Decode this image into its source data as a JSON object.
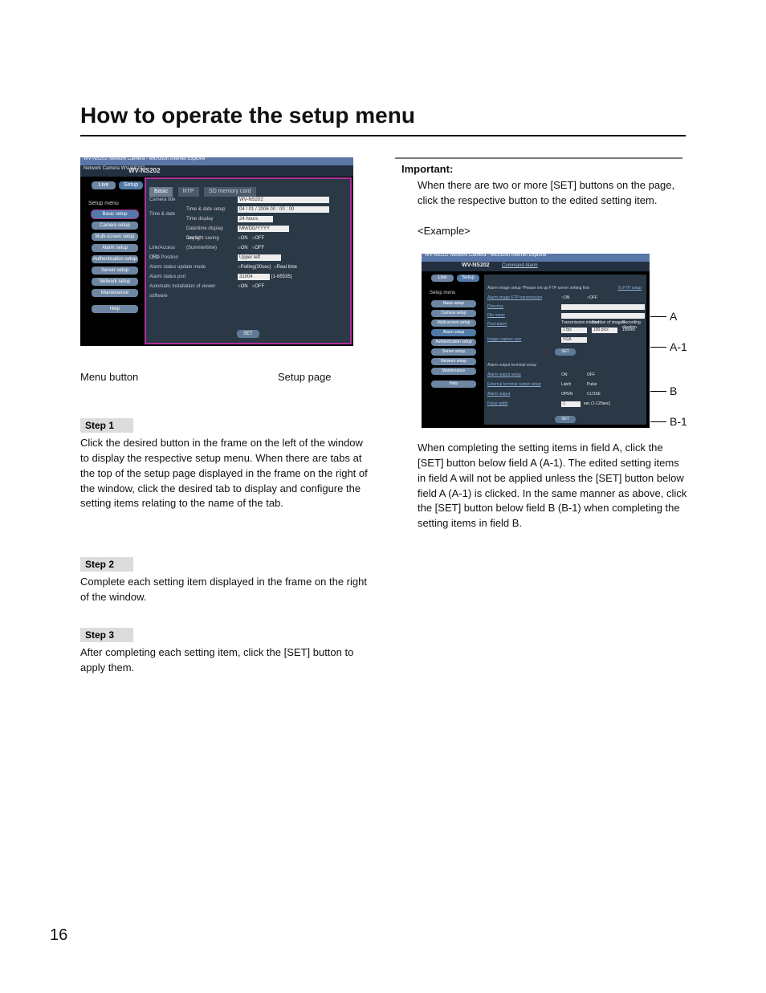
{
  "title": "How to operate the setup menu",
  "pageNumber": "16",
  "leftColumn": {
    "shot1": {
      "windowTitle": "WV-NS202 Network Camera - Microsoft Internet Explorer",
      "cameraLabel": "Network Camera\nWV-NS202",
      "cameraTag": "WV-NS202",
      "topBtnLive": "Live",
      "topBtnSetup": "Setup",
      "menuTitle": "Setup menu",
      "menuItems": [
        "Basic setup",
        "Camera setup",
        "Multi-screen setup",
        "Alarm setup",
        "Authentication setup",
        "Server setup",
        "Network setup",
        "Maintenance",
        "Help"
      ],
      "tabs": [
        "Basic",
        "NTP",
        "SD memory card"
      ],
      "rows": {
        "camTitleLabel": "Camera title",
        "camTitleValue": "WV-NS202",
        "timeSection": "Time & date",
        "tds": "Time & date setup",
        "tds_value": "04 / 01 / 2006   00 : 00 : 00",
        "td_disp": "Time display",
        "td_disp_value": "24 hours",
        "dtf": "Date/time display format",
        "dtf_value": "MM/DD/YYYY",
        "dls": "Daylight saving (Summertime)",
        "dls_on": "ON",
        "dls_off": "OFF",
        "led": "Link/Access LED",
        "led_on": "ON",
        "led_off": "OFF",
        "osd": "OSD Position",
        "osd_value": "Upper left",
        "asum": "Alarm status update mode",
        "asum_a": "Polling(30sec)",
        "asum_b": "Real time",
        "asp": "Alarm status port",
        "asp_val": "31004",
        "asp_hint": "(1-65535)",
        "auto": "Automatic installation of viewer software",
        "auto_on": "ON",
        "auto_off": "OFF",
        "setBtn": "SET"
      },
      "label_menu": "Menu button",
      "label_page": "Setup page"
    },
    "step1": {
      "title": "Step 1",
      "body": "Click the desired button in the frame on the left of the window to display the respective setup menu.\nWhen there are tabs at the top of the setup page displayed in the frame on the right of the window, click the desired tab to display and configure the setting items relating to the name of the tab."
    },
    "step2": {
      "title": "Step 2",
      "body": "Complete each setting item displayed in the frame on the right of the window."
    },
    "step3": {
      "title": "Step 3",
      "body": "After completing each setting item, click the [SET] button to apply them."
    }
  },
  "rightColumn": {
    "important": "Important:",
    "importantBody": "When there are two or more [SET] buttons on the page, click the respective button to the edited setting item.",
    "exampleLabel": "<Example>",
    "shot2": {
      "windowTitle": "WV-NS202 Network Camera - Microsoft Internet Explorer",
      "cameraTag": "WV-NS202",
      "cameraAlarm": "Command Alarm",
      "topBtnLive": "Live",
      "topBtnSetup": "Setup",
      "menuTitle": "Setup menu",
      "menuItems": [
        "Basic setup",
        "Camera setup",
        "Multi-screen setup",
        "Alarm setup",
        "Authentication setup",
        "Server setup",
        "Network setup",
        "Maintenance",
        "Help"
      ],
      "fieldA": {
        "header": "Alarm image setup   *Please set up FTP server setting first",
        "ftpLink": "To FTP setup",
        "r1_label": "Alarm image FTP transmission",
        "r1_on": "ON",
        "r1_off": "OFF",
        "r2_label": "Directory",
        "r3_label": "File name",
        "r4_label": "Post-alarm",
        "r4_h1": "Transmission interval",
        "r4_h2": "Number of images",
        "r4_h3": "Recording duration",
        "r4_v1": "1 fps",
        "r4_v2": "100 pics",
        "r4_v3": "100sec",
        "r5_label": "Image capture size",
        "r5_val": "VGA"
      },
      "fieldB": {
        "header": "Alarm output terminal setup",
        "r1_label": "Alarm output setup",
        "r1_on": "ON",
        "r1_off": "OFF",
        "r2_label": "External terminal output setup",
        "r2_a": "Latch",
        "r2_b": "Pulse",
        "r3_label": "Alarm output",
        "r3_a": "OPEN",
        "r3_b": "CLOSE",
        "r4_label": "Pulse width",
        "r4_val": "1",
        "r4_hint": "sec (1-120sec)"
      },
      "setBtn": "SET"
    },
    "markers": {
      "A": "A",
      "A1": "A-1",
      "B": "B",
      "B1": "B-1"
    },
    "body2": "When completing the setting items in field A, click the [SET] button below field A (A-1). The edited setting items in field A will not be applied unless the [SET] button below field A (A-1) is clicked.\nIn the same manner as above, click the [SET] button below field B (B-1) when completing the setting items in field B."
  }
}
